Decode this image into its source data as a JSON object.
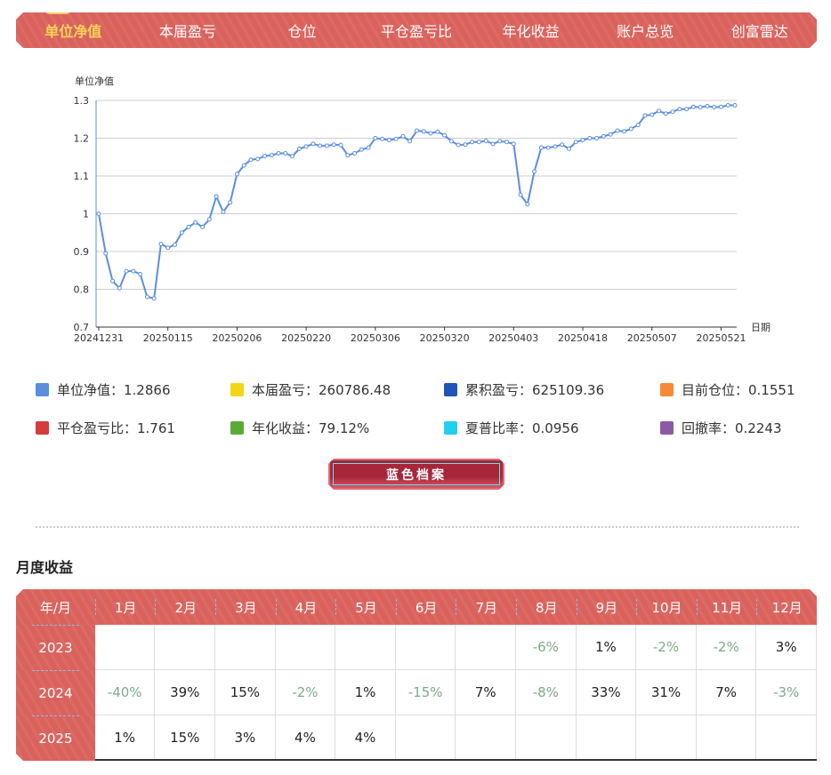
{
  "nav": {
    "tabs": [
      "单位净值",
      "本届盈亏",
      "仓位",
      "平仓盈亏比",
      "年化收益",
      "账户总览",
      "创富雷达"
    ],
    "active": 0
  },
  "chart_data": {
    "type": "line",
    "title": "",
    "ylabel": "单位净值",
    "xlabel": "日期",
    "ylim": [
      0.7,
      1.3
    ],
    "yticks": [
      "0.7",
      "0.8",
      "0.9",
      "1",
      "1.1",
      "1.2",
      "1.3"
    ],
    "xticks": [
      "20241231",
      "20250115",
      "20250206",
      "20250220",
      "20250306",
      "20250320",
      "20250403",
      "20250418",
      "20250507",
      "20250521"
    ],
    "xtick_every": 10,
    "grid": true,
    "color": "#5b8ee0",
    "values": [
      1.0,
      0.895,
      0.822,
      0.803,
      0.848,
      0.848,
      0.84,
      0.78,
      0.776,
      0.92,
      0.91,
      0.918,
      0.95,
      0.965,
      0.977,
      0.965,
      0.985,
      1.046,
      1.005,
      1.03,
      1.105,
      1.128,
      1.143,
      1.145,
      1.153,
      1.155,
      1.16,
      1.16,
      1.152,
      1.172,
      1.178,
      1.185,
      1.18,
      1.18,
      1.183,
      1.182,
      1.155,
      1.16,
      1.17,
      1.175,
      1.2,
      1.198,
      1.195,
      1.198,
      1.205,
      1.192,
      1.22,
      1.218,
      1.213,
      1.217,
      1.208,
      1.192,
      1.182,
      1.183,
      1.19,
      1.19,
      1.193,
      1.185,
      1.192,
      1.19,
      1.185,
      1.05,
      1.025,
      1.112,
      1.175,
      1.175,
      1.178,
      1.183,
      1.172,
      1.19,
      1.195,
      1.2,
      1.2,
      1.205,
      1.21,
      1.22,
      1.218,
      1.225,
      1.235,
      1.26,
      1.262,
      1.272,
      1.265,
      1.27,
      1.277,
      1.277,
      1.283,
      1.282,
      1.285,
      1.282,
      1.283,
      1.287,
      1.287
    ]
  },
  "legend": [
    {
      "label": "单位净值：1.2866",
      "color": "#5b8ee0"
    },
    {
      "label": "本届盈亏：260786.48",
      "color": "#f2d516"
    },
    {
      "label": "累积盈亏：625109.36",
      "color": "#1f55b8"
    },
    {
      "label": "目前仓位：0.1551",
      "color": "#f68b37"
    },
    {
      "label": "平仓盈亏比：1.761",
      "color": "#d63c3c"
    },
    {
      "label": "年化收益：79.12%",
      "color": "#5aab36"
    },
    {
      "label": "夏普比率：0.0956",
      "color": "#22cfee"
    },
    {
      "label": "回撤率：0.2243",
      "color": "#8a5aa6"
    }
  ],
  "button": "蓝色档案",
  "monthly": {
    "title": "月度收益",
    "header": [
      "年/月",
      "1月",
      "2月",
      "3月",
      "4月",
      "5月",
      "6月",
      "7月",
      "8月",
      "9月",
      "10月",
      "11月",
      "12月"
    ],
    "rows": [
      {
        "year": "2023",
        "cells": [
          "",
          "",
          "",
          "",
          "",
          "",
          "",
          "-6%",
          "1%",
          "-2%",
          "-2%",
          "3%"
        ]
      },
      {
        "year": "2024",
        "cells": [
          "-40%",
          "39%",
          "15%",
          "-2%",
          "1%",
          "-15%",
          "7%",
          "-8%",
          "33%",
          "31%",
          "7%",
          "-3%"
        ]
      },
      {
        "year": "2025",
        "cells": [
          "1%",
          "15%",
          "3%",
          "4%",
          "4%",
          "",
          "",
          "",
          "",
          "",
          "",
          ""
        ]
      }
    ]
  }
}
